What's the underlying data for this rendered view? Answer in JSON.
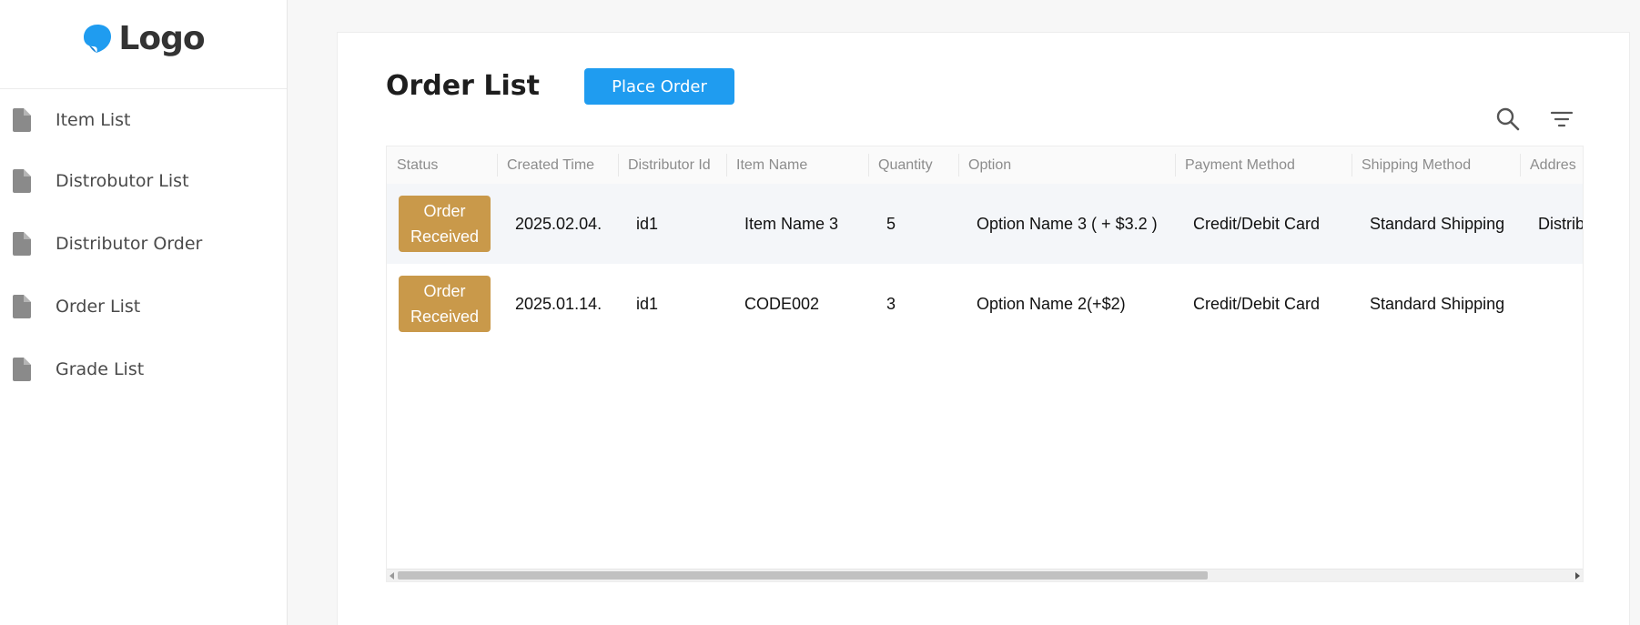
{
  "logo": {
    "text": "Logo",
    "color": "#1f9cf0"
  },
  "sidebar": {
    "items": [
      {
        "label": "Item List",
        "icon": "document-icon"
      },
      {
        "label": "Distrobutor List",
        "icon": "document-icon"
      },
      {
        "label": "Distributor Order",
        "icon": "document-icon"
      },
      {
        "label": "Order List",
        "icon": "document-icon"
      },
      {
        "label": "Grade List",
        "icon": "document-icon"
      }
    ]
  },
  "main": {
    "title": "Order List",
    "place_order_label": "Place Order",
    "accent_color": "#1f9cf0",
    "toolbar_icons": [
      "search-icon",
      "filter-icon"
    ]
  },
  "table": {
    "columns": [
      "Status",
      "Created Time",
      "Distributor Id",
      "Item Name",
      "Quantity",
      "Option",
      "Payment Method",
      "Shipping Method",
      "Addres"
    ],
    "status_color": "#c9994a",
    "rows": [
      {
        "status_line1": "Order",
        "status_line2": "Received",
        "created_time": "2025.02.04.",
        "distributor_id": "id1",
        "item_name": "Item Name 3",
        "quantity": "5",
        "option": "Option Name 3 ( + $3.2 )",
        "payment_method": "Credit/Debit Card",
        "shipping_method": "Standard Shipping",
        "address": "Distrib"
      },
      {
        "status_line1": "Order",
        "status_line2": "Received",
        "created_time": "2025.01.14.",
        "distributor_id": "id1",
        "item_name": "CODE002",
        "quantity": "3",
        "option": "Option Name 2(+$2)",
        "payment_method": "Credit/Debit Card",
        "shipping_method": "Standard Shipping",
        "address": ""
      }
    ]
  }
}
